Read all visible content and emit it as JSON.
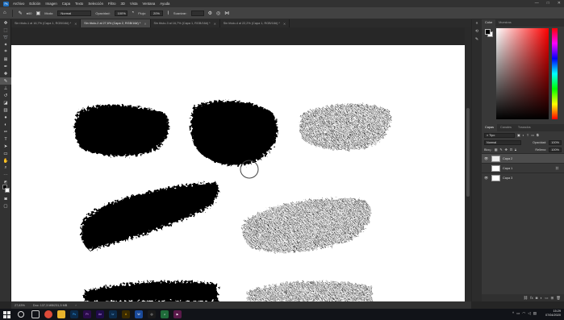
{
  "menubar": {
    "logo": "Ps",
    "items": [
      "Archivo",
      "Edición",
      "Imagen",
      "Capa",
      "Texto",
      "Selección",
      "Filtro",
      "3D",
      "Vista",
      "Ventana",
      "Ayuda"
    ],
    "window_controls": [
      "—",
      "□",
      "✕"
    ]
  },
  "options_bar": {
    "brush_size": "60",
    "mode_label": "Modo:",
    "mode_value": "Normal",
    "opacity_label": "Opacidad:",
    "opacity_value": "100%",
    "flow_label": "Flujo:",
    "flow_value": "20%",
    "smoothing_label": "Suavizar:"
  },
  "tabs": [
    {
      "label": "Sin título-1 al 16,7% (Capa 1, RGB/16#) *",
      "active": false
    },
    {
      "label": "Sin título-2 al 27,6% (Capa 2, RGB/16#) *",
      "active": true
    },
    {
      "label": "Sin título-3 al 16,7% (Capa 1, RGB/16#) *",
      "active": false
    },
    {
      "label": "Sin título-4 al 22,2% (Capa 1, RGB/16#) *",
      "active": false
    }
  ],
  "status": {
    "zoom": "27,63%",
    "doc_size": "Doc: 137,3 MB/231,5 MB"
  },
  "color_panel": {
    "tabs": [
      "Color",
      "Muestras"
    ],
    "fg_color": "#000000",
    "bg_color": "#ffffff",
    "hue_color": "#ff0000"
  },
  "layers_panel": {
    "tabs": [
      "Capas",
      "Canales",
      "Trazados"
    ],
    "filter_label": "Tipo",
    "blend_mode": "Normal",
    "opacity_label": "Opacidad:",
    "opacity_value": "100%",
    "lock_label": "Bloq.:",
    "fill_label": "Relleno:",
    "fill_value": "100%",
    "layers": [
      {
        "name": "Capa 2",
        "selected": true
      },
      {
        "name": "Capa 1",
        "selected": false
      },
      {
        "name": "Capa 3",
        "selected": false
      }
    ]
  },
  "taskbar": {
    "apps": [
      {
        "icon": "Ps",
        "color": "#0b2a4a"
      },
      {
        "icon": "Pr",
        "color": "#2a0b4a"
      },
      {
        "icon": "Ae",
        "color": "#1f0b4a"
      },
      {
        "icon": "Lr",
        "color": "#0b2a4a"
      },
      {
        "icon": "A",
        "color": "#3a2b00"
      },
      {
        "icon": "W",
        "color": "#1a4a9a"
      },
      {
        "icon": "◎",
        "color": "#1b1b1b"
      },
      {
        "icon": "♫",
        "color": "#1f6b3a"
      },
      {
        "icon": "▶",
        "color": "#5a1a4a"
      }
    ],
    "time": "15:29",
    "date": "07/04/2020"
  }
}
